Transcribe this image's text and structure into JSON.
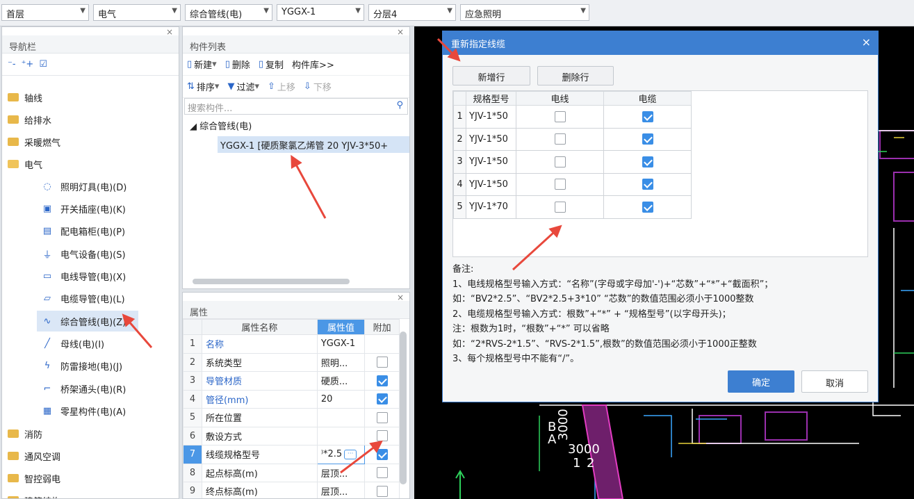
{
  "toolbar": {
    "combos": [
      {
        "value": "首层"
      },
      {
        "value": "电气"
      },
      {
        "value": "综合管线(电)"
      },
      {
        "value": "YGGX-1"
      },
      {
        "value": "分层4"
      },
      {
        "value": "应急照明"
      }
    ]
  },
  "nav": {
    "title": "导航栏",
    "tools": [
      "⁻-",
      "⁺+",
      "☑"
    ],
    "items": [
      {
        "label": "轴线",
        "type": "folder"
      },
      {
        "label": "给排水",
        "type": "folder"
      },
      {
        "label": "采暖燃气",
        "type": "folder"
      },
      {
        "label": "电气",
        "type": "folder-open"
      },
      {
        "label": "照明灯具(电)(D)",
        "type": "sub",
        "icon": "bulb-icon",
        "glyph": "◌"
      },
      {
        "label": "开关插座(电)(K)",
        "type": "sub",
        "icon": "switch-icon",
        "glyph": "▣"
      },
      {
        "label": "配电箱柜(电)(P)",
        "type": "sub",
        "icon": "cabinet-icon",
        "glyph": "▤"
      },
      {
        "label": "电气设备(电)(S)",
        "type": "sub",
        "icon": "plug-icon",
        "glyph": "⏚"
      },
      {
        "label": "电线导管(电)(X)",
        "type": "sub",
        "icon": "conduit-icon",
        "glyph": "▭"
      },
      {
        "label": "电缆导管(电)(L)",
        "type": "sub",
        "icon": "cable-conduit-icon",
        "glyph": "▱"
      },
      {
        "label": "综合管线(电)(Z)",
        "type": "sub",
        "icon": "pipeline-icon",
        "glyph": "∿",
        "selected": true
      },
      {
        "label": "母线(电)(I)",
        "type": "sub",
        "icon": "busbar-icon",
        "glyph": "╱"
      },
      {
        "label": "防雷接地(电)(J)",
        "type": "sub",
        "icon": "lightning-icon",
        "glyph": "ϟ"
      },
      {
        "label": "桥架通头(电)(R)",
        "type": "sub",
        "icon": "bridge-icon",
        "glyph": "⌐"
      },
      {
        "label": "零星构件(电)(A)",
        "type": "sub",
        "icon": "grid-icon",
        "glyph": "▦"
      },
      {
        "label": "消防",
        "type": "folder"
      },
      {
        "label": "通风空调",
        "type": "folder"
      },
      {
        "label": "智控弱电",
        "type": "folder"
      },
      {
        "label": "建筑结构",
        "type": "folder"
      }
    ]
  },
  "component_list": {
    "title": "构件列表",
    "row1": [
      {
        "label": "新建",
        "icon": "new-icon",
        "glyph": "▯",
        "dropdown": true
      },
      {
        "label": "删除",
        "icon": "delete-icon",
        "glyph": "▯"
      },
      {
        "label": "复制",
        "icon": "copy-icon",
        "glyph": "▯"
      },
      {
        "label": "构件库>>",
        "icon": "",
        "glyph": ""
      }
    ],
    "row2": [
      {
        "label": "排序",
        "icon": "sort-icon",
        "glyph": "⇅",
        "dropdown": true
      },
      {
        "label": "过滤",
        "icon": "filter-icon",
        "glyph": "▼",
        "dropdown": true
      },
      {
        "label": "上移",
        "icon": "move-up-icon",
        "glyph": "⇧",
        "disabled": true
      },
      {
        "label": "下移",
        "icon": "move-down-icon",
        "glyph": "⇩",
        "disabled": true
      }
    ],
    "search_placeholder": "搜索构件...",
    "tree_root": "综合管线(电)",
    "tree_child": "YGGX-1 [硬质聚氯乙烯管 20 YJV-3*50+"
  },
  "properties": {
    "title": "属性",
    "headers": [
      "属性名称",
      "属性值",
      "附加"
    ],
    "rows": [
      {
        "idx": "1",
        "name": "名称",
        "value": "YGGX-1",
        "blue": true,
        "check": null
      },
      {
        "idx": "2",
        "name": "系统类型",
        "value": "照明...",
        "blue": false,
        "check": false
      },
      {
        "idx": "3",
        "name": "导管材质",
        "value": "硬质...",
        "blue": true,
        "check": true
      },
      {
        "idx": "4",
        "name": "管径(mm)",
        "value": "20",
        "blue": true,
        "check": true
      },
      {
        "idx": "5",
        "name": "所在位置",
        "value": "",
        "blue": false,
        "check": false
      },
      {
        "idx": "6",
        "name": "敷设方式",
        "value": "",
        "blue": false,
        "check": false
      },
      {
        "idx": "7",
        "name": "线缆规格型号",
        "value": "⁾*2.5",
        "blue": false,
        "check": true,
        "selected": true
      },
      {
        "idx": "8",
        "name": "起点标高(m)",
        "value": "层顶...",
        "blue": false,
        "check": false
      },
      {
        "idx": "9",
        "name": "终点标高(m)",
        "value": "层顶...",
        "blue": false,
        "check": false
      }
    ]
  },
  "dialog": {
    "title": "重新指定线缆",
    "add_row": "新增行",
    "delete_row": "删除行",
    "headers": [
      "规格型号",
      "电线",
      "电缆"
    ],
    "rows": [
      {
        "idx": "1",
        "spec": "YJV-1*50",
        "wire": false,
        "cable": true
      },
      {
        "idx": "2",
        "spec": "YJV-1*50",
        "wire": false,
        "cable": true
      },
      {
        "idx": "3",
        "spec": "YJV-1*50",
        "wire": false,
        "cable": true
      },
      {
        "idx": "4",
        "spec": "YJV-1*50",
        "wire": false,
        "cable": true
      },
      {
        "idx": "5",
        "spec": "YJV-1*70",
        "wire": false,
        "cable": true
      }
    ],
    "notes": [
      "备注:",
      "1、电线规格型号输入方式：“名称”(字母或字母加'-')+“芯数”+“*”+“截面积”；",
      "如：“BV2*2.5”、“BV2*2.5+3*10” “芯数”的数值范围必须小于1000整数",
      "2、电缆规格型号输入方式：根数”+“*” + “规格型号”(以字母开头)；",
      "注：根数为1时，“根数”+“*” 可以省略",
      "如：“2*RVS-2*1.5”、“RVS-2*1.5”,根数”的数值范围必须小于1000正整数",
      "3、每个规格型号中不能有“/”。"
    ],
    "ok": "确定",
    "cancel": "取消"
  },
  "cad": {
    "texts": [
      "B",
      "A",
      "3000",
      "3000",
      "1",
      "2"
    ]
  },
  "colors": {
    "accent": "#3d7fd1",
    "selection": "#4b97e6",
    "arrow": "#e8483c"
  }
}
